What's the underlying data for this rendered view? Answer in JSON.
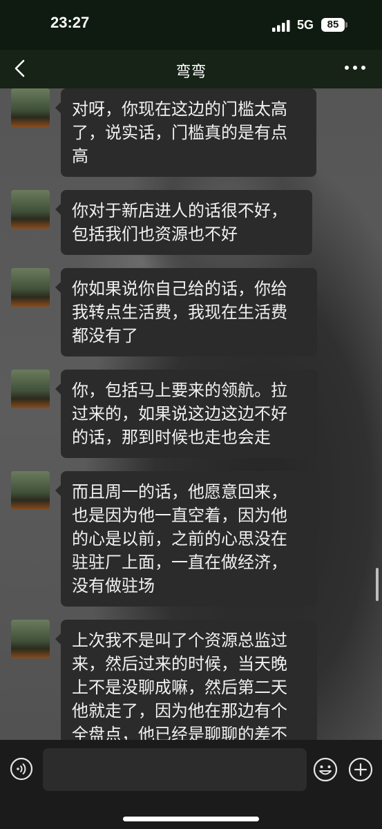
{
  "status_bar": {
    "time": "23:27",
    "network": "5G",
    "battery": "85"
  },
  "header": {
    "title": "弯弯"
  },
  "messages": [
    {
      "lines": [
        "对呀，你现在这边的门槛太高",
        "了，说实话，门槛真的是有点",
        "高"
      ]
    },
    {
      "lines": [
        "你对于新店进人的话很不好，",
        "包括我们也资源也不好"
      ]
    },
    {
      "lines": [
        "你如果说你自己给的话，你给",
        "我转点生活费，我现在生活费",
        "都没有了"
      ]
    },
    {
      "lines": [
        "你，包括马上要来的领航。拉",
        "过来的，如果说这边这边不好",
        "的话，那到时候也走也会走"
      ]
    },
    {
      "lines": [
        "而且周一的话，他愿意回来，",
        "也是因为他一直空着，因为他",
        "的心是以前，之前的心思没在",
        "驻驻厂上面，一直在做经济，",
        "没有做驻场"
      ]
    },
    {
      "lines": [
        "上次我不是叫了个资源总监过",
        "来，然后过来的时候，当天晚",
        "上不是没聊成嘛，然后第二天",
        "他就走了，因为他在那边有个",
        "全盘点，他已经是聊聊的差不"
      ]
    }
  ],
  "input_bar": {
    "value": ""
  },
  "colors": {
    "status_bg": "#0f1a10",
    "nav_bg": "#162316",
    "bubble_bg": "#2b2b2b",
    "bottom_bg": "#1b1b1b"
  },
  "icons": [
    "back-arrow-icon",
    "more-icon",
    "voice-icon",
    "emoji-icon",
    "plus-icon"
  ]
}
